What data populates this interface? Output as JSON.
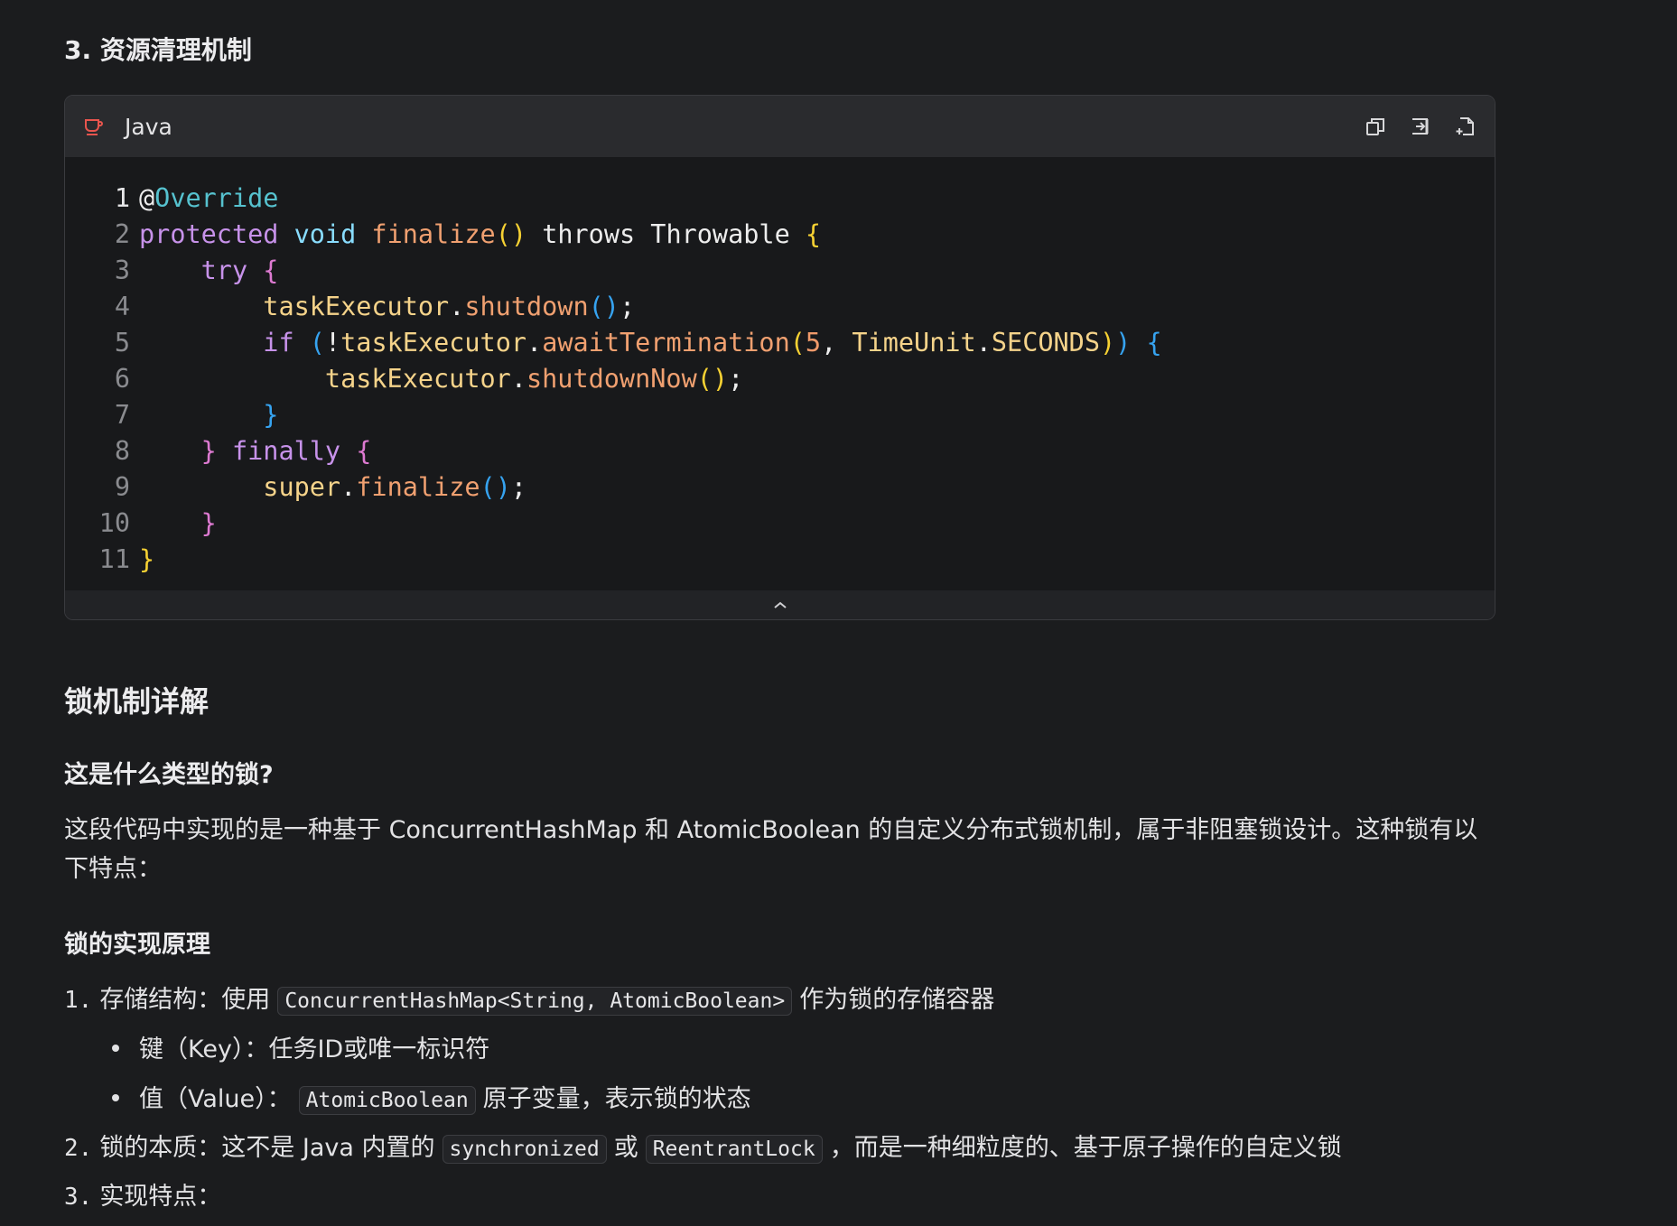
{
  "section_heading": "3. 资源清理机制",
  "code_block": {
    "language": "Java",
    "lines": [
      {
        "n": "1"
      },
      {
        "n": "2"
      },
      {
        "n": "3"
      },
      {
        "n": "4"
      },
      {
        "n": "5"
      },
      {
        "n": "6"
      },
      {
        "n": "7"
      },
      {
        "n": "8"
      },
      {
        "n": "9"
      },
      {
        "n": "10"
      },
      {
        "n": "11"
      }
    ],
    "tokens": {
      "l1": [
        "@",
        "Override"
      ],
      "l2": [
        "protected",
        " ",
        "void",
        " ",
        "finalize",
        "()",
        " throws Throwable ",
        "{"
      ],
      "l3": [
        "    ",
        "try",
        " ",
        "{"
      ],
      "l4": [
        "        ",
        "taskExecutor",
        ".",
        "shutdown",
        "()",
        ";"
      ],
      "l5": [
        "        ",
        "if",
        " ",
        "(",
        "!",
        "taskExecutor",
        ".",
        "awaitTermination",
        "(",
        "5",
        ", ",
        "TimeUnit",
        ".",
        "SECONDS",
        ")",
        ")",
        " ",
        "{"
      ],
      "l6": [
        "            ",
        "taskExecutor",
        ".",
        "shutdownNow",
        "()",
        ";"
      ],
      "l7": [
        "        ",
        "}"
      ],
      "l8": [
        "    ",
        "}",
        " ",
        "finally",
        " ",
        "{"
      ],
      "l9": [
        "        ",
        "super",
        ".",
        "finalize",
        "()",
        ";"
      ],
      "l10": [
        "    ",
        "}"
      ],
      "l11": [
        "}"
      ]
    },
    "icons": {
      "lang": "coffee-cup-icon",
      "copy": "copy-icon",
      "insert": "insert-icon",
      "new_file": "new-file-icon",
      "collapse": "chevron-up-icon"
    },
    "colors": {
      "keyword": "#c792ea",
      "type": "#89ddff",
      "function": "#f0a070",
      "variable": "#f5d38a",
      "bracket_yellow": "#f6d133",
      "bracket_pink": "#dd7ad1",
      "bracket_blue": "#36a3f0"
    }
  },
  "lock_heading": "锁机制详解",
  "question_heading": "这是什么类型的锁?",
  "intro_paragraph": "这段代码中实现的是一种基于 ConcurrentHashMap 和 AtomicBoolean 的自定义分布式锁机制，属于非阻塞锁设计。这种锁有以下特点：",
  "principle_heading": "锁的实现原理",
  "list": {
    "item1": {
      "num": "1.",
      "before": "存储结构：使用",
      "code": "ConcurrentHashMap<String, AtomicBoolean>",
      "after": "作为锁的存储容器",
      "sub": [
        {
          "text": "键（Key）：任务ID或唯一标识符"
        },
        {
          "before": "值（Value）：",
          "code": "AtomicBoolean",
          "after": "原子变量，表示锁的状态"
        }
      ]
    },
    "item2": {
      "num": "2.",
      "before": "锁的本质：这不是 Java 内置的",
      "code1": "synchronized",
      "mid": "或",
      "code2": "ReentrantLock",
      "after": "，而是一种细粒度的、基于原子操作的自定义锁"
    },
    "item3": {
      "num": "3.",
      "text": "实现特点："
    }
  }
}
